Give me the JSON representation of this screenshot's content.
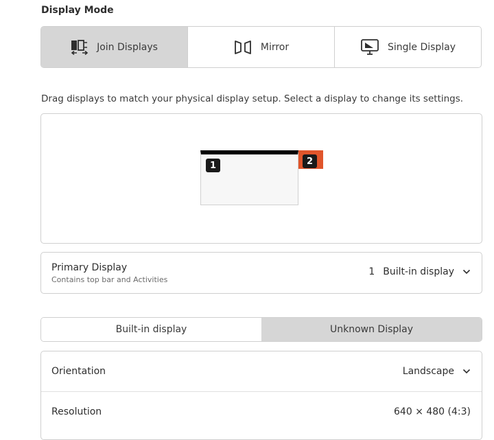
{
  "display_mode": {
    "title": "Display Mode",
    "options": [
      {
        "label": "Join Displays",
        "icon": "join-displays-icon",
        "active": true
      },
      {
        "label": "Mirror",
        "icon": "mirror-icon",
        "active": false
      },
      {
        "label": "Single Display",
        "icon": "single-display-icon",
        "active": false
      }
    ]
  },
  "arrangement": {
    "hint": "Drag displays to match your physical display setup. Select a display to change its settings.",
    "monitors": [
      {
        "number": "1",
        "color": "#000000"
      },
      {
        "number": "2",
        "color": "#e0552b"
      }
    ]
  },
  "primary_display": {
    "title": "Primary Display",
    "subtitle": "Contains top bar and Activities",
    "number": "1",
    "value": "Built-in display"
  },
  "display_tabs": [
    "Built-in display",
    "Unknown Display"
  ],
  "settings": {
    "orientation": {
      "label": "Orientation",
      "value": "Landscape"
    },
    "resolution": {
      "label": "Resolution",
      "value": "640 × 480 (4:3)"
    }
  },
  "colors": {
    "accent_secondary_display": "#e0552b",
    "selected_toggle_bg": "#d6d6d6",
    "border": "#cfcfcf"
  }
}
